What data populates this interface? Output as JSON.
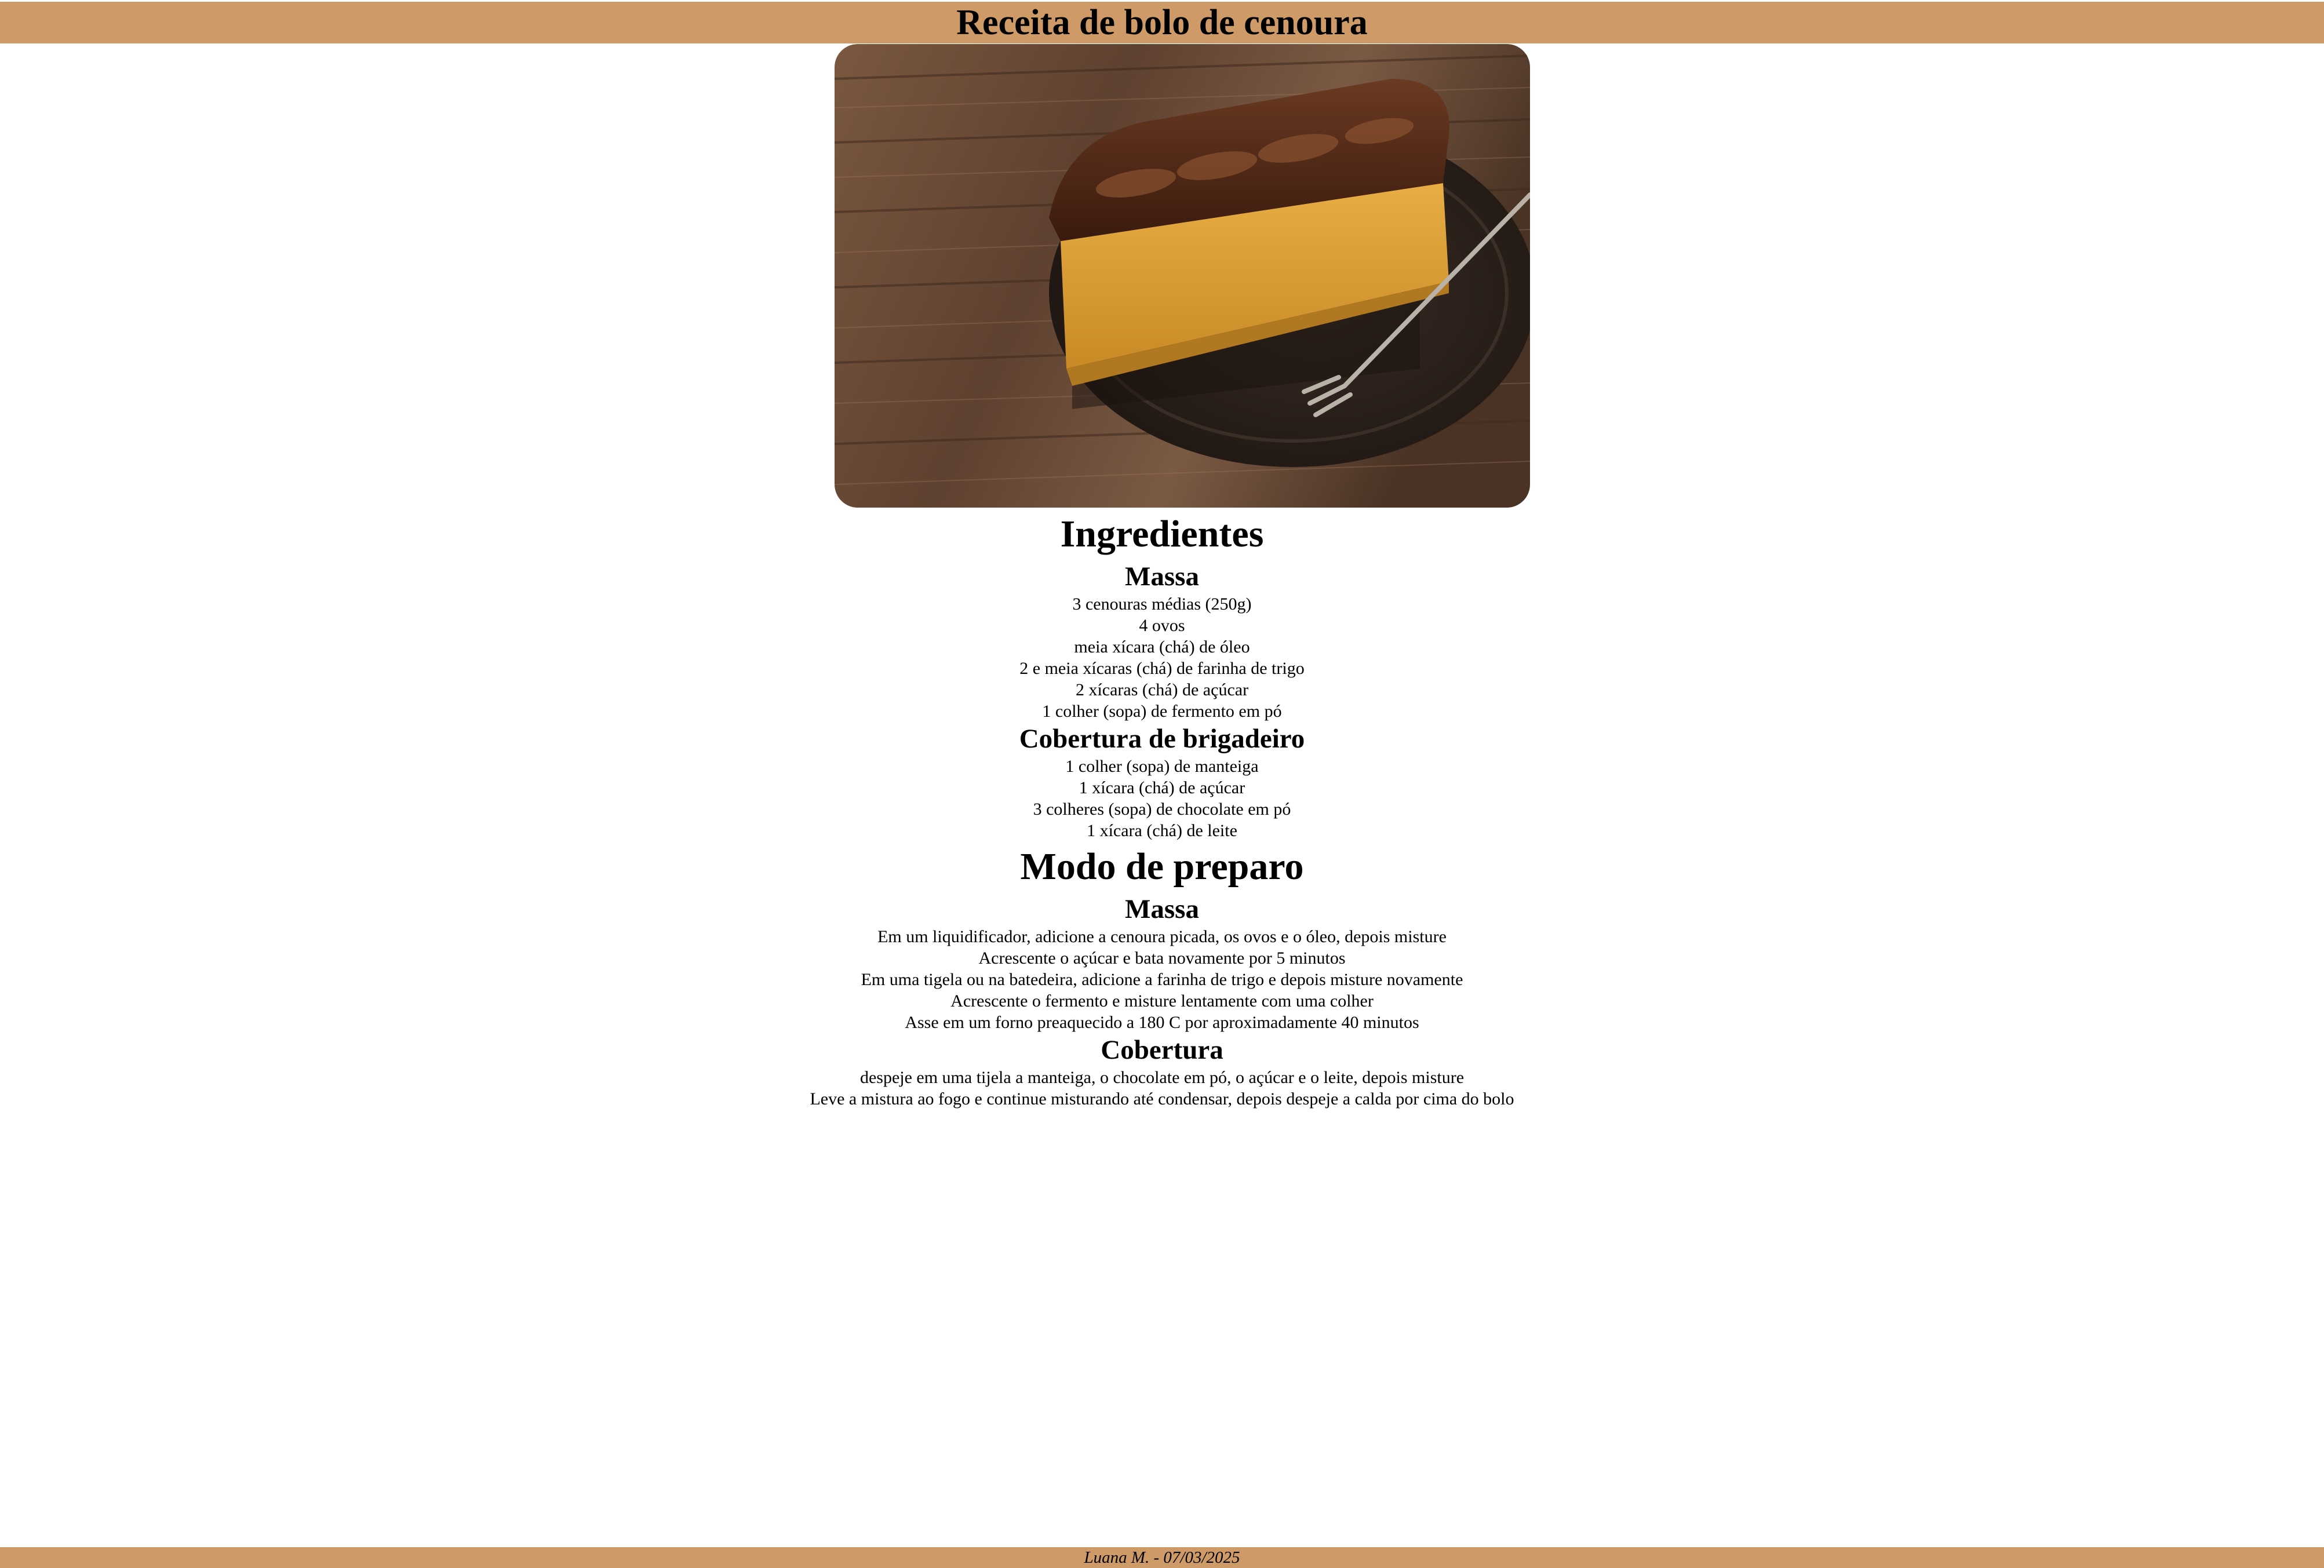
{
  "header": {
    "title": "Receita de bolo de cenoura"
  },
  "image": {
    "icon": "carrot-cake-photo",
    "colors": {
      "wood": "#6b4a35",
      "plate": "#2b211c",
      "cake": "#e0a23a",
      "chocolate": "#4a2414"
    }
  },
  "ingredients": {
    "title": "Ingredientes",
    "dough": {
      "title": "Massa",
      "items": [
        "3 cenouras médias (250g)",
        "4 ovos",
        "meia xícara (chá) de óleo",
        "2 e meia xícaras (chá) de farinha de trigo",
        "2 xícaras (chá) de açúcar",
        "1 colher (sopa) de fermento em pó"
      ]
    },
    "topping": {
      "title": "Cobertura de brigadeiro",
      "items": [
        "1 colher (sopa) de manteiga",
        "1 xícara (chá) de açúcar",
        "3 colheres (sopa) de chocolate em pó",
        "1 xícara (chá) de leite"
      ]
    }
  },
  "preparation": {
    "title": "Modo de preparo",
    "dough": {
      "title": "Massa",
      "steps": [
        "Em um liquidificador, adicione a cenoura picada, os ovos e o óleo, depois misture",
        "Acrescente o açúcar e bata novamente por 5 minutos",
        "Em uma tigela ou na batedeira, adicione a farinha de trigo e depois misture novamente",
        "Acrescente o fermento e misture lentamente com uma colher",
        "Asse em um forno preaquecido a 180 C por aproximadamente 40 minutos"
      ]
    },
    "topping": {
      "title": "Cobertura",
      "steps": [
        "despeje em uma tijela a manteiga, o chocolate em pó, o açúcar e o leite, depois misture",
        "Leve a mistura ao fogo e continue misturando até condensar, depois despeje a calda por cima do bolo"
      ]
    }
  },
  "footer": {
    "text": "Luana M. - 07/03/2025"
  },
  "theme": {
    "bar_color": "#cd9a68"
  }
}
